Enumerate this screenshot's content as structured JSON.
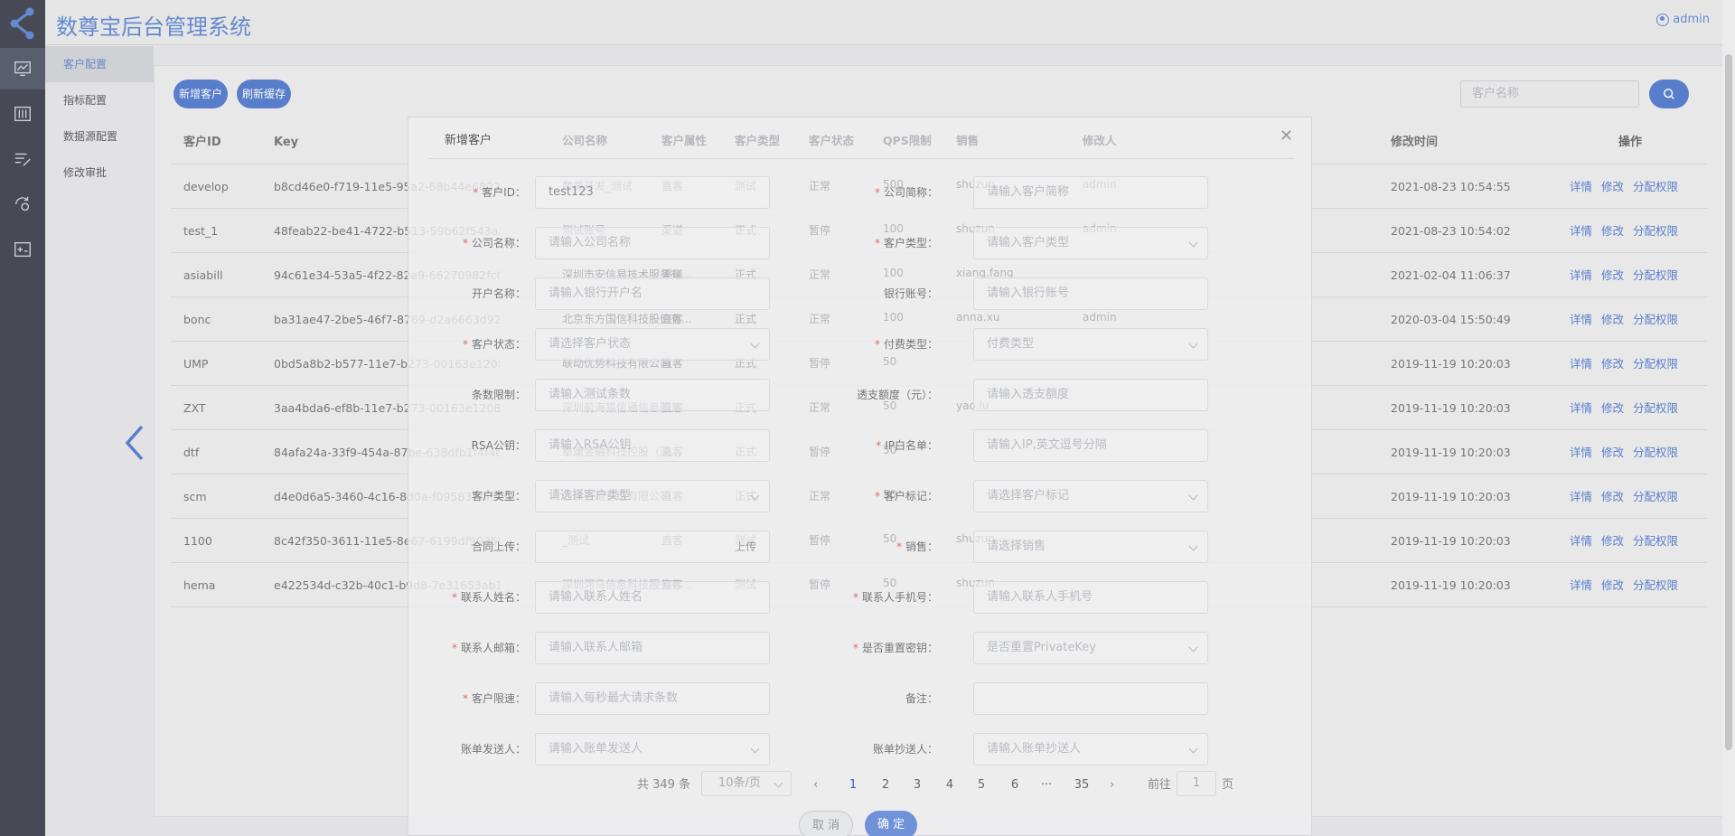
{
  "app": {
    "title": "数尊宝后台管理系统",
    "user": "admin"
  },
  "rail": [
    {
      "icon": "monitor-chart-icon"
    },
    {
      "icon": "sliders-icon"
    },
    {
      "icon": "list-edit-icon"
    },
    {
      "icon": "gear-refresh-icon"
    },
    {
      "icon": "add-panel-icon"
    }
  ],
  "submenu": [
    "客户配置",
    "指标配置",
    "数据源配置",
    "修改审批"
  ],
  "toolbar": {
    "add_label": "新增客户",
    "refresh_label": "刷新缓存",
    "search_placeholder": "客户名称"
  },
  "table": {
    "headers": {
      "id": "客户ID",
      "key": "Key",
      "time": "修改时间",
      "ops": "操作"
    },
    "rows": [
      {
        "id": "develop",
        "key": "b8cd46e0-f719-11e5-95a2-68b44e682271",
        "time": "2021-08-23 10:54:55"
      },
      {
        "id": "test_1",
        "key": "48feab22-be41-4722-b513-59b62f543a39",
        "time": "2021-08-23 10:54:02"
      },
      {
        "id": "asiabill",
        "key": "94c61e34-53a5-4f22-82a9-66270982fc09",
        "time": "2021-02-04 11:06:37"
      },
      {
        "id": "bonc",
        "key": "ba31ae47-2be5-46f7-8769-d2a6663d924c",
        "time": "2020-03-04 15:50:49"
      },
      {
        "id": "UMP",
        "key": "0bd5a8b2-b577-11e7-b273-00163e120846",
        "time": "2019-11-19 10:20:03"
      },
      {
        "id": "ZXT",
        "key": "3aa4bda6-ef8b-11e7-b273-00163e120846",
        "time": "2019-11-19 10:20:03"
      },
      {
        "id": "dtf",
        "key": "84afa24a-33f9-454a-87be-638dfb1f4f4d",
        "time": "2019-11-19 10:20:03"
      },
      {
        "id": "scm",
        "key": "d4e0d6a5-3460-4c16-8d0a-f095832f4f38",
        "time": "2019-11-19 10:20:03"
      },
      {
        "id": "1100",
        "key": "8c42f350-3611-11e5-8e67-6199df903557",
        "time": "2019-11-19 10:20:03"
      },
      {
        "id": "hema",
        "key": "e422534d-c32b-40c1-b9d8-7e31653ab1b9",
        "time": "2019-11-19 10:20:03"
      }
    ],
    "ops": {
      "detail": "详情",
      "edit": "修改",
      "perm": "分配权限"
    },
    "ghost_headers": [
      "公司名称",
      "客户属性",
      "客户类型",
      "客户状态",
      "QPS限制",
      "销售",
      "修改人"
    ],
    "ghost_rows": [
      [
        "数尊开发_测试",
        "直客",
        "测试",
        "正常",
        "500",
        "shuzun",
        "admin"
      ],
      [
        "测试账号",
        "渠道",
        "正式",
        "暂停",
        "100",
        "shuzun",
        "admin"
      ],
      [
        "深圳市安信易技术服务有...",
        "渠道",
        "正式",
        "正常",
        "100",
        "xiang.fang",
        ""
      ],
      [
        "北京东方国信科技股份有...",
        "直客",
        "正式",
        "正常",
        "100",
        "anna.xu",
        "admin"
      ],
      [
        "联动优势科技有限公司",
        "直客",
        "正式",
        "暂停",
        "50",
        "",
        ""
      ],
      [
        "深圳前海猫信通信息服务...",
        "直客",
        "正式",
        "正常",
        "50",
        "yao.lu",
        ""
      ],
      [
        "泰康金融科技控股（深...",
        "直客",
        "正式",
        "暂停",
        "50",
        "",
        ""
      ],
      [
        "云供应链管理有限公司",
        "直客",
        "正式",
        "正常",
        "50",
        "",
        ""
      ],
      [
        "_测试",
        "直客",
        "测试",
        "暂停",
        "50",
        "shuzun",
        ""
      ],
      [
        "深圳河马信息科技服务有...",
        "直客",
        "测试",
        "暂停",
        "50",
        "shuzun",
        ""
      ]
    ]
  },
  "modal": {
    "title": "新增客户",
    "fields_left": [
      {
        "label": "客户ID：",
        "required": true,
        "value": "test123",
        "placeholder": "",
        "select": false
      },
      {
        "label": "公司名称：",
        "required": true,
        "value": "",
        "placeholder": "请输入公司名称",
        "select": false
      },
      {
        "label": "开户名称：",
        "required": false,
        "value": "",
        "placeholder": "请输入银行开户名",
        "select": false
      },
      {
        "label": "客户状态：",
        "required": true,
        "value": "",
        "placeholder": "请选择客户状态",
        "select": true
      },
      {
        "label": "条数限制：",
        "required": false,
        "value": "",
        "placeholder": "请输入测试条数",
        "select": false
      },
      {
        "label": "RSA公钥：",
        "required": false,
        "value": "",
        "placeholder": "请输入RSA公钥",
        "select": false
      },
      {
        "label": "客户类型：",
        "required": false,
        "value": "",
        "placeholder": "请选择客户类型",
        "select": true
      },
      {
        "label": "合同上传：",
        "required": false,
        "value": "",
        "placeholder": "",
        "select": false,
        "upload": "上传"
      },
      {
        "label": "联系人姓名：",
        "required": true,
        "value": "",
        "placeholder": "请输入联系人姓名",
        "select": false
      },
      {
        "label": "联系人邮箱：",
        "required": true,
        "value": "",
        "placeholder": "请输入联系人邮箱",
        "select": false
      },
      {
        "label": "客户限速：",
        "required": true,
        "value": "",
        "placeholder": "请输入每秒最大请求条数",
        "select": false
      },
      {
        "label": "账单发送人：",
        "required": false,
        "value": "",
        "placeholder": "请输入账单发送人",
        "select": true
      }
    ],
    "fields_right": [
      {
        "label": "公司简称：",
        "required": true,
        "value": "",
        "placeholder": "请输入客户简称",
        "select": false
      },
      {
        "label": "客户类型：",
        "required": true,
        "value": "",
        "placeholder": "请输入客户类型",
        "select": true
      },
      {
        "label": "银行账号：",
        "required": false,
        "value": "",
        "placeholder": "请输入银行账号",
        "select": false
      },
      {
        "label": "付费类型：",
        "required": true,
        "value": "",
        "placeholder": "付费类型",
        "select": true
      },
      {
        "label": "透支额度（元）：",
        "required": false,
        "value": "",
        "placeholder": "请输入透支额度",
        "select": false
      },
      {
        "label": "IP白名单：",
        "required": true,
        "value": "",
        "placeholder": "请输入IP,英文逗号分隔",
        "select": false
      },
      {
        "label": "客户标记：",
        "required": true,
        "value": "",
        "placeholder": "请选择客户标记",
        "select": true
      },
      {
        "label": "销售：",
        "required": true,
        "value": "",
        "placeholder": "请选择销售",
        "select": true
      },
      {
        "label": "联系人手机号：",
        "required": true,
        "value": "",
        "placeholder": "请输入联系人手机号",
        "select": false
      },
      {
        "label": "是否重置密钥：",
        "required": true,
        "value": "",
        "placeholder": "是否重置PrivateKey",
        "select": true
      },
      {
        "label": "备注：",
        "required": false,
        "value": "",
        "placeholder": "",
        "select": false
      },
      {
        "label": "账单抄送人：",
        "required": false,
        "value": "",
        "placeholder": "请输入账单抄送人",
        "select": true
      }
    ],
    "cancel_label": "取 消",
    "confirm_label": "确 定"
  },
  "pagination": {
    "total": "共 349 条",
    "page_size": "10条/页",
    "pages": [
      "1",
      "2",
      "3",
      "4",
      "5",
      "6",
      "···",
      "35"
    ],
    "prev": "‹",
    "next": "›",
    "goto_label": "前往",
    "goto_value": "1",
    "page_suffix": "页"
  },
  "colors": {
    "primary": "#2d5fc4",
    "rail_bg": "#161a26"
  }
}
